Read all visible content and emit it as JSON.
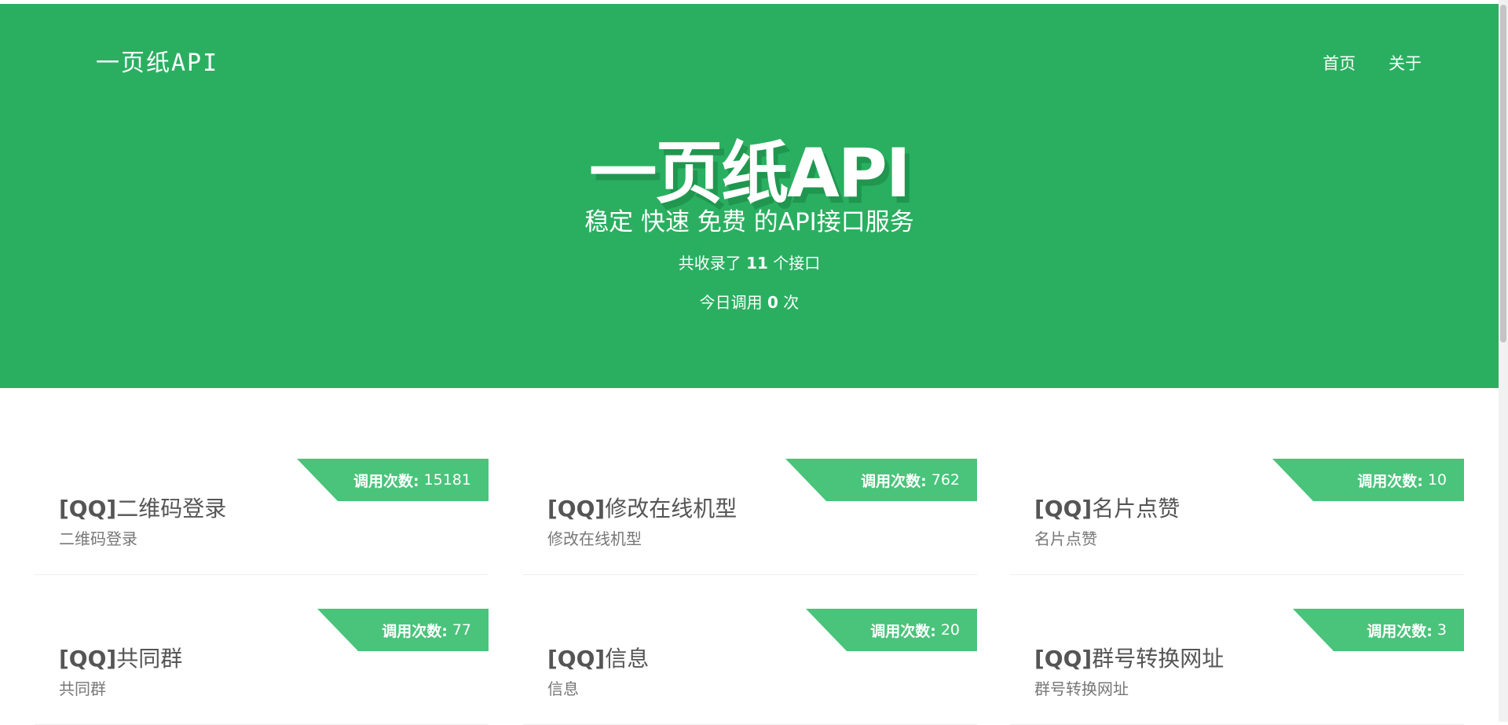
{
  "brand": {
    "logo": "一页纸API"
  },
  "nav": {
    "items": [
      {
        "label": "首页"
      },
      {
        "label": "关于"
      }
    ]
  },
  "hero": {
    "title": "一页纸API",
    "subtitle": "稳定 快速 免费 的API接口服务",
    "stat1_prefix": "共收录了 ",
    "stat1_value": "11",
    "stat1_suffix": " 个接口",
    "stat2_prefix": "今日调用 ",
    "stat2_value": "0",
    "stat2_suffix": " 次"
  },
  "cards": [
    {
      "prefix": "[QQ]",
      "name": "二维码登录",
      "desc": "二维码登录",
      "calls_label": "调用次数:",
      "calls": "15181"
    },
    {
      "prefix": "[QQ]",
      "name": "修改在线机型",
      "desc": "修改在线机型",
      "calls_label": "调用次数:",
      "calls": "762"
    },
    {
      "prefix": "[QQ]",
      "name": "名片点赞",
      "desc": "名片点赞",
      "calls_label": "调用次数:",
      "calls": "10"
    },
    {
      "prefix": "[QQ]",
      "name": "共同群",
      "desc": "共同群",
      "calls_label": "调用次数:",
      "calls": "77"
    },
    {
      "prefix": "[QQ]",
      "name": "信息",
      "desc": "信息",
      "calls_label": "调用次数:",
      "calls": "20"
    },
    {
      "prefix": "[QQ]",
      "name": "群号转换网址",
      "desc": "群号转换网址",
      "calls_label": "调用次数:",
      "calls": "3"
    }
  ],
  "colors": {
    "hero_bg": "#2aaf60",
    "ribbon_bg": "#4ac37b",
    "title_text": "#555555",
    "desc_text": "#777777"
  }
}
